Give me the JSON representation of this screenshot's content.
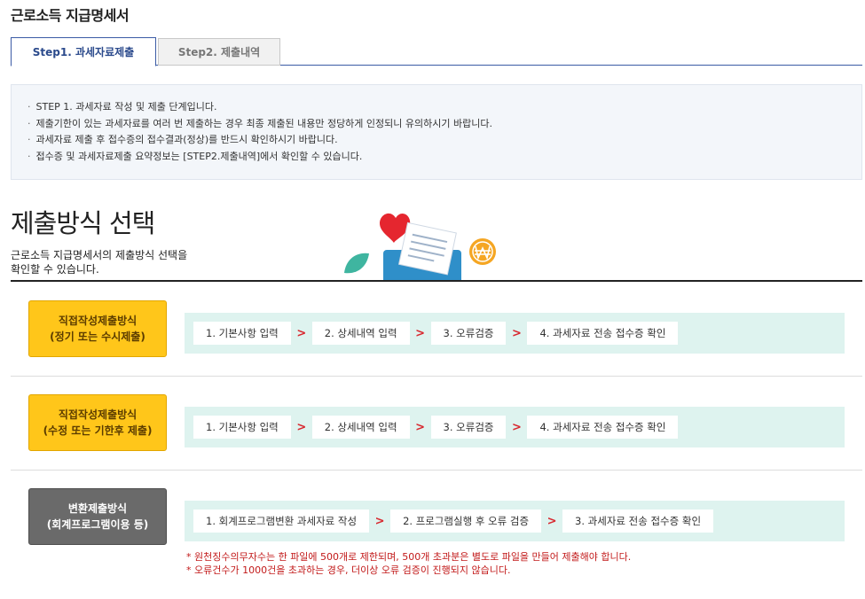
{
  "page": {
    "title": "근로소득 지급명세서"
  },
  "tabs": [
    {
      "label": "Step1. 과세자료제출",
      "active": true
    },
    {
      "label": "Step2. 제출내역",
      "active": false
    }
  ],
  "info": {
    "items": [
      "STEP 1. 과세자료 작성 및 제출 단계입니다.",
      "제출기한이 있는 과세자료를 여러 번 제출하는 경우 최종 제출된 내용만 정당하게 인정되니 유의하시기 바랍니다.",
      "과세자료 제출 후 접수증의 접수결과(정상)를 반드시 확인하시기 바랍니다.",
      "접수증 및 과세자료제출 요약정보는 [STEP2.제출내역]에서 확인할 수 있습니다."
    ]
  },
  "section": {
    "title": "제출방식 선택",
    "desc_line1": "근로소득 지급명세서의 제출방식 선택을",
    "desc_line2": "확인할 수 있습니다."
  },
  "methods": [
    {
      "line1": "직접작성제출방식",
      "line2": "(정기 또는 수시제출)",
      "steps": [
        "1. 기본사항 입력",
        "2. 상세내역 입력",
        "3. 오류검증",
        "4. 과세자료 전송 접수증 확인"
      ]
    },
    {
      "line1": "직접작성제출방식",
      "line2": "(수정 또는 기한후 제출)",
      "steps": [
        "1. 기본사항 입력",
        "2. 상세내역 입력",
        "3. 오류검증",
        "4. 과세자료 전송 접수증 확인"
      ]
    },
    {
      "line1": "변환제출방식",
      "line2": "(회계프로그램이용 등)",
      "steps": [
        "1. 회계프로그램변환 과세자료 작성",
        "2. 프로그램실행 후 오류 검증",
        "3. 과세자료 전송 접수증 확인"
      ]
    }
  ],
  "notes": [
    "* 원천징수의무자수는 한 파일에 500개로 제한되며, 500개 초과분은 별도로 파일을 만들어 제출해야 합니다.",
    "* 오류건수가 1000건을 초과하는 경우, 더이상 오류 검증이 진행되지 않습니다."
  ],
  "arrow_glyph": ">",
  "colors": {
    "accent_blue": "#3b5ba5",
    "method_yellow": "#ffc61a",
    "method_gray": "#6a6a6a",
    "flow_bg": "#def3ef",
    "arrow_red": "#d8282f",
    "note_red": "#c21a1a"
  },
  "icons": [
    "heart-icon",
    "leaf-icon",
    "document-envelope-icon",
    "won-coin-icon"
  ]
}
